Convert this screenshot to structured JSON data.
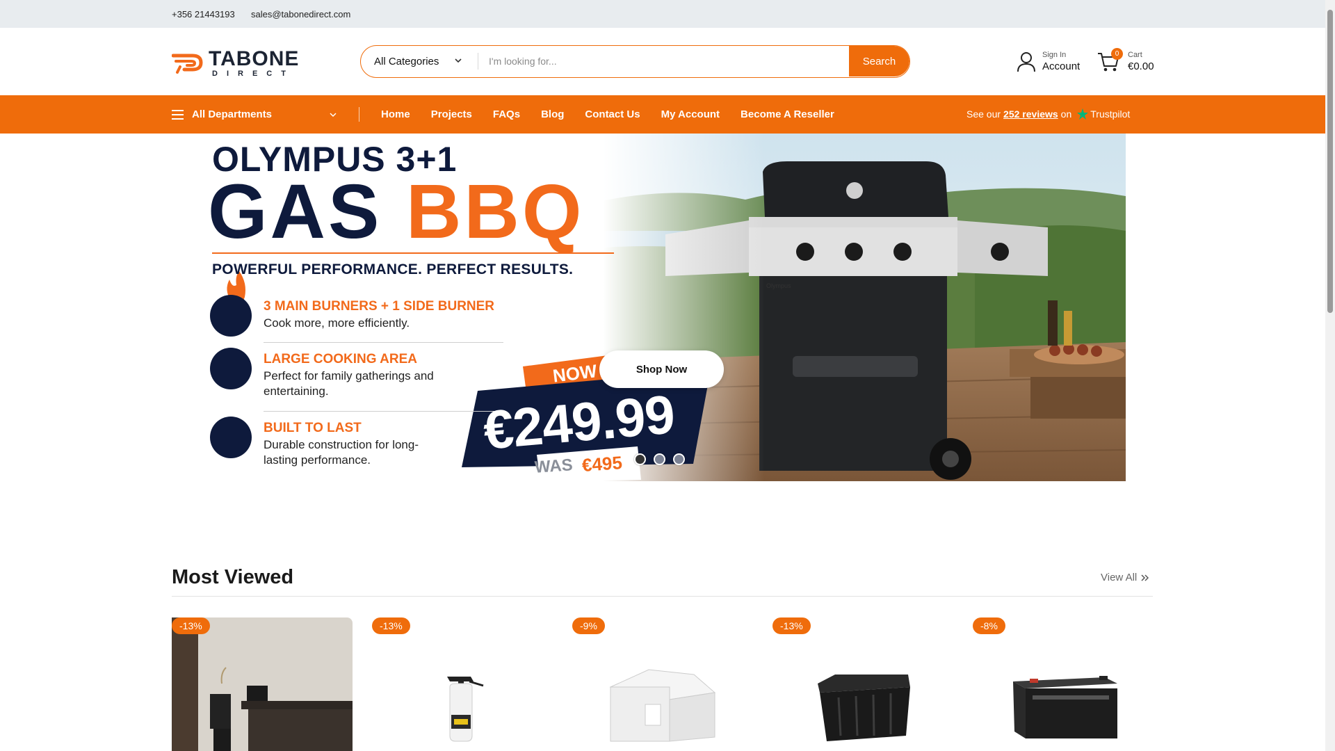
{
  "topbar": {
    "phone": "+356 21443193",
    "email": "sales@tabonedirect.com"
  },
  "header": {
    "logo_word": "TABONE",
    "logo_sub": "DIRECT",
    "search": {
      "category": "All Categories",
      "placeholder": "I'm looking for...",
      "button": "Search"
    },
    "account": {
      "small": "Sign In",
      "big": "Account"
    },
    "cart": {
      "count": "0",
      "small": "Cart",
      "big": "€0.00"
    }
  },
  "nav": {
    "departments": "All Departments",
    "items": [
      "Home",
      "Projects",
      "FAQs",
      "Blog",
      "Contact Us",
      "My Account",
      "Become A Reseller"
    ],
    "reviews_prefix": "See our",
    "reviews_link": "252 reviews",
    "reviews_suffix": "on",
    "trustpilot": "Trustpilot"
  },
  "hero": {
    "title_line1": "OLYMPUS 3+1",
    "title_gas": "GAS",
    "title_bbq": "BBQ",
    "tagline": "POWERFUL PERFORMANCE. PERFECT RESULTS.",
    "features": [
      {
        "title": "3 MAIN BURNERS + 1 SIDE BURNER",
        "desc": "Cook more, more efficiently."
      },
      {
        "title": "LARGE COOKING AREA",
        "desc": "Perfect for family gatherings and entertaining."
      },
      {
        "title": "BUILT TO LAST",
        "desc": "Durable construction for long-lasting performance."
      }
    ],
    "now_label": "NOW",
    "price": "€249.99",
    "was_label": "WAS",
    "was_price": "€495",
    "shop_button": "Shop Now",
    "grill_brand": "Olympus",
    "slides": 3,
    "active_slide": 1
  },
  "most_viewed": {
    "title": "Most Viewed",
    "view_all": "View All",
    "products": [
      {
        "discount": "-13%",
        "image": "office-desk-chair"
      },
      {
        "discount": "-13%",
        "image": "pressure-sprayer"
      },
      {
        "discount": "-9%",
        "image": "white-gazebo"
      },
      {
        "discount": "-13%",
        "image": "storage-box"
      },
      {
        "discount": "-8%",
        "image": "battery"
      }
    ]
  },
  "colors": {
    "accent": "#ef6c0b",
    "navy": "#0e1a3c",
    "topbar": "#e8ecef"
  }
}
